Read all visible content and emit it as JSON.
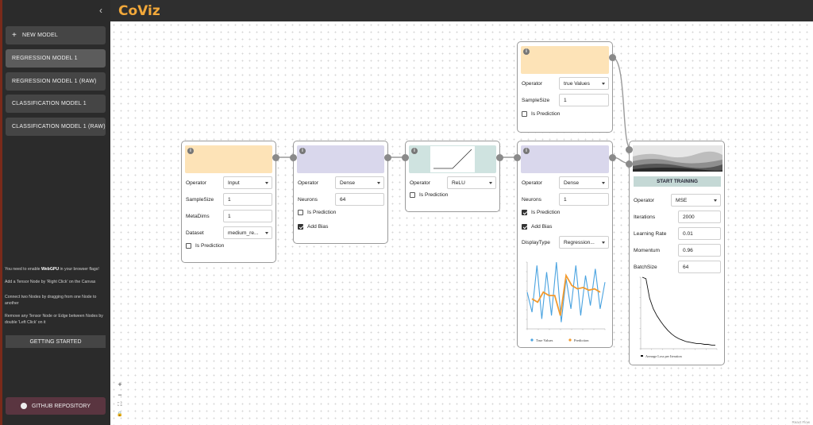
{
  "app": {
    "title": "CoViz"
  },
  "sidebar": {
    "collapse_icon": "chevron-left-icon",
    "new_model_label": "NEW MODEL",
    "models": [
      {
        "label": "REGRESSION MODEL 1",
        "active": true
      },
      {
        "label": "REGRESSION MODEL 1 (RAW)",
        "active": false
      },
      {
        "label": "CLASSIFICATION MODEL 1",
        "active": false
      },
      {
        "label": "CLASSIFICATION MODEL 1 (RAW)",
        "active": false
      }
    ],
    "help": {
      "webgpu_pre": "You need to enable ",
      "webgpu_bold": "WebGPU",
      "webgpu_post": " in your browser flags!",
      "tip_add": "Add a Tensor Node by 'Right Click' on the Canvas",
      "tip_connect": "Connect two Nodes by dragging from one Node to another",
      "tip_remove": "Remove any Tensor Node or Edge between Nodes by double 'Left Click' on it"
    },
    "getting_started_label": "GETTING STARTED",
    "github_label": "GITHUB REPOSITORY"
  },
  "canvas": {
    "zoom_in": "+",
    "zoom_out": "−",
    "fit": "⛶",
    "lock": "🔒",
    "credit": "React Flow"
  },
  "colors": {
    "input_head": "#fde3b7",
    "dense_head": "#d9d7ec",
    "relu_head": "#cfe3e0",
    "train_head": "#fde3b7",
    "chart_blue": "#4aa3e0",
    "chart_orange": "#f29a2e",
    "button_teal": "#c4d8d5"
  },
  "nodes": {
    "input": {
      "operator_label": "Operator",
      "operator_value": "Input",
      "samplesize_label": "SampleSize",
      "samplesize_value": "1",
      "metadims_label": "MetaDims",
      "metadims_value": "1",
      "dataset_label": "Dataset",
      "dataset_value": "medium_re...",
      "is_prediction_label": "Is Prediction",
      "is_prediction": false
    },
    "dense1": {
      "operator_label": "Operator",
      "operator_value": "Dense",
      "neurons_label": "Neurons",
      "neurons_value": "64",
      "is_prediction_label": "Is Prediction",
      "is_prediction": false,
      "add_bias_label": "Add Bias",
      "add_bias": true
    },
    "relu": {
      "operator_label": "Operator",
      "operator_value": "ReLU",
      "is_prediction_label": "Is Prediction",
      "is_prediction": false
    },
    "dense2": {
      "operator_label": "Operator",
      "operator_value": "Dense",
      "neurons_label": "Neurons",
      "neurons_value": "1",
      "is_prediction_label": "Is Prediction",
      "is_prediction": true,
      "add_bias_label": "Add Bias",
      "add_bias": true,
      "displaytype_label": "DisplayType",
      "displaytype_value": "Regression...",
      "legend_true": "True Values",
      "legend_pred": "Prediction"
    },
    "truevalues": {
      "operator_label": "Operator",
      "operator_value": "true Values",
      "samplesize_label": "SampleSize",
      "samplesize_value": "1",
      "is_prediction_label": "Is Prediction",
      "is_prediction": false
    },
    "train": {
      "start_label": "START TRAINING",
      "operator_label": "Operator",
      "operator_value": "MSE",
      "iterations_label": "Iterations",
      "iterations_value": "2000",
      "lr_label": "Learning Rate",
      "lr_value": "0.01",
      "momentum_label": "Momentum",
      "momentum_value": "0.96",
      "batch_label": "BatchSize",
      "batch_value": "64",
      "loss_legend": "Average Loss per Iteration"
    }
  },
  "chart_data": [
    {
      "type": "line",
      "series": [
        {
          "name": "True Values",
          "values": [
            0.55,
            0.25,
            0.95,
            0.15,
            0.85,
            0.2,
            1.0,
            0.1,
            0.75,
            0.3,
            0.95,
            0.2,
            0.8,
            0.35,
            0.9,
            0.3,
            0.7
          ]
        },
        {
          "name": "Prediction",
          "values": [
            0.45,
            0.4,
            0.55,
            0.5,
            0.5,
            0.2,
            0.8,
            0.65,
            0.6,
            0.62,
            0.58,
            0.6,
            0.55
          ]
        }
      ],
      "legend": "bottom"
    },
    {
      "type": "line",
      "series": [
        {
          "name": "Average Loss per Iteration",
          "values": [
            1.0,
            0.98,
            0.7,
            0.55,
            0.45,
            0.37,
            0.3,
            0.24,
            0.19,
            0.15,
            0.12,
            0.1,
            0.08,
            0.07,
            0.06,
            0.05,
            0.05,
            0.04,
            0.04,
            0.03,
            0.03
          ]
        }
      ],
      "legend": "bottom"
    }
  ]
}
